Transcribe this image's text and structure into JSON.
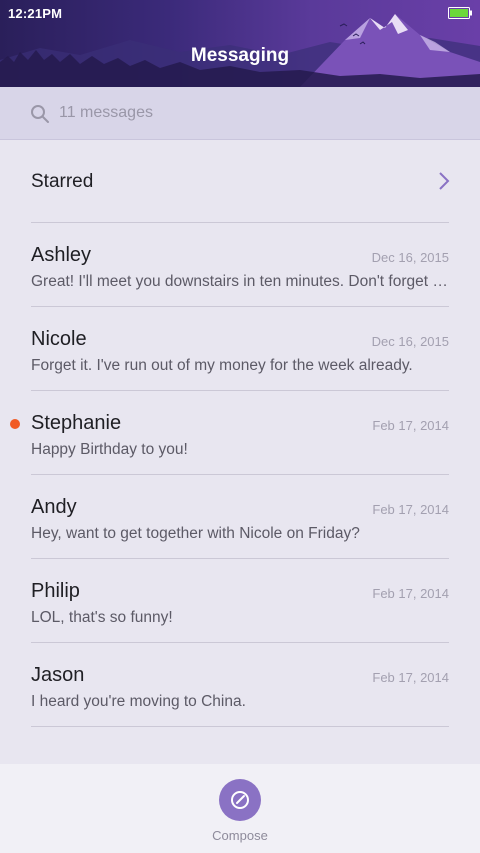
{
  "status_bar": {
    "time": "12:21PM",
    "battery_icon": "battery-full-icon",
    "battery_color": "#6cd83a"
  },
  "header": {
    "title": "Messaging"
  },
  "search": {
    "placeholder": "11 messages",
    "icon": "search-icon"
  },
  "starred": {
    "label": "Starred",
    "icon": "chevron-right-icon"
  },
  "messages": [
    {
      "name": "Ashley",
      "date": "Dec 16, 2015",
      "preview": "Great! I'll meet you downstairs in ten minutes. Don't forget your umbrella.",
      "unread": false
    },
    {
      "name": "Nicole",
      "date": "Dec 16, 2015",
      "preview": "Forget it. I've run out of my money for the week already.",
      "unread": false
    },
    {
      "name": "Stephanie",
      "date": "Feb 17, 2014",
      "preview": "Happy Birthday to you!",
      "unread": true
    },
    {
      "name": "Andy",
      "date": "Feb 17, 2014",
      "preview": "Hey, want to get together with Nicole on Friday?",
      "unread": false
    },
    {
      "name": "Philip",
      "date": "Feb 17, 2014",
      "preview": "LOL, that's so funny!",
      "unread": false
    },
    {
      "name": "Jason",
      "date": "Feb 17, 2014",
      "preview": "I heard you're moving to China.",
      "unread": false
    }
  ],
  "compose": {
    "label": "Compose",
    "icon": "compose-icon",
    "color": "#8a72c4"
  },
  "colors": {
    "unread_dot": "#f15a24",
    "header_gradient_start": "#2a1f5a",
    "header_gradient_end": "#6a3fa8"
  }
}
